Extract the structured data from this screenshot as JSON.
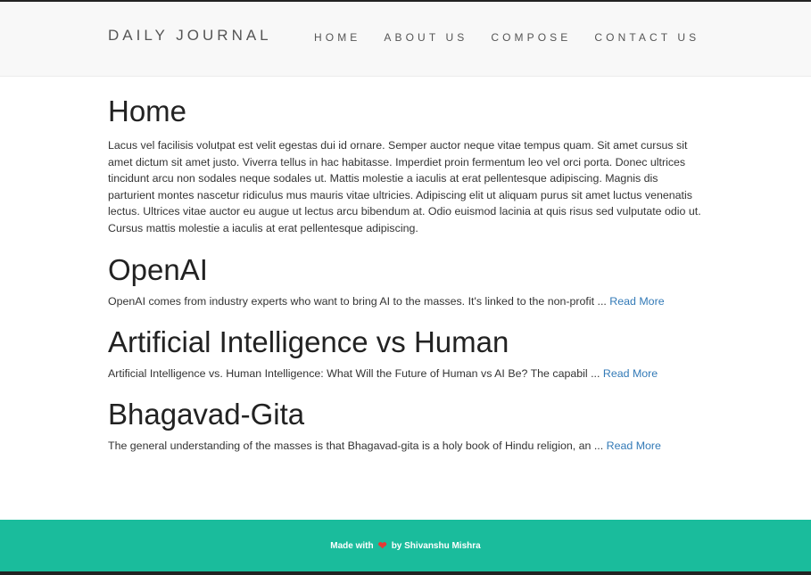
{
  "header": {
    "brand": "DAILY JOURNAL",
    "nav": [
      {
        "label": "HOME"
      },
      {
        "label": "ABOUT US"
      },
      {
        "label": "COMPOSE"
      },
      {
        "label": "CONTACT US"
      }
    ]
  },
  "main": {
    "title": "Home",
    "intro": "Lacus vel facilisis volutpat est velit egestas dui id ornare. Semper auctor neque vitae tempus quam. Sit amet cursus sit amet dictum sit amet justo. Viverra tellus in hac habitasse. Imperdiet proin fermentum leo vel orci porta. Donec ultrices tincidunt arcu non sodales neque sodales ut. Mattis molestie a iaculis at erat pellentesque adipiscing. Magnis dis parturient montes nascetur ridiculus mus mauris vitae ultricies. Adipiscing elit ut aliquam purus sit amet luctus venenatis lectus. Ultrices vitae auctor eu augue ut lectus arcu bibendum at. Odio euismod lacinia at quis risus sed vulputate odio ut. Cursus mattis molestie a iaculis at erat pellentesque adipiscing.",
    "posts": [
      {
        "title": "OpenAI",
        "excerpt": "OpenAI comes from industry experts who want to bring AI to the masses. It's linked to the non-profit ...",
        "read_more": "Read More"
      },
      {
        "title": "Artificial Intelligence vs Human",
        "excerpt": "Artificial Intelligence vs. Human Intelligence: What Will the Future of Human vs AI Be? The capabil ...",
        "read_more": "Read More"
      },
      {
        "title": "Bhagavad-Gita",
        "excerpt": "The general understanding of the masses is that Bhagavad-gita is a holy book of Hindu religion, an ...",
        "read_more": "Read More"
      }
    ]
  },
  "footer": {
    "made_with": "Made with",
    "by": "by Shivanshu Mishra",
    "heart_icon": "heart-icon"
  },
  "colors": {
    "footer_bg": "#1abc9c",
    "link": "#337ab7",
    "navbar_bg": "#f8f8f8"
  }
}
